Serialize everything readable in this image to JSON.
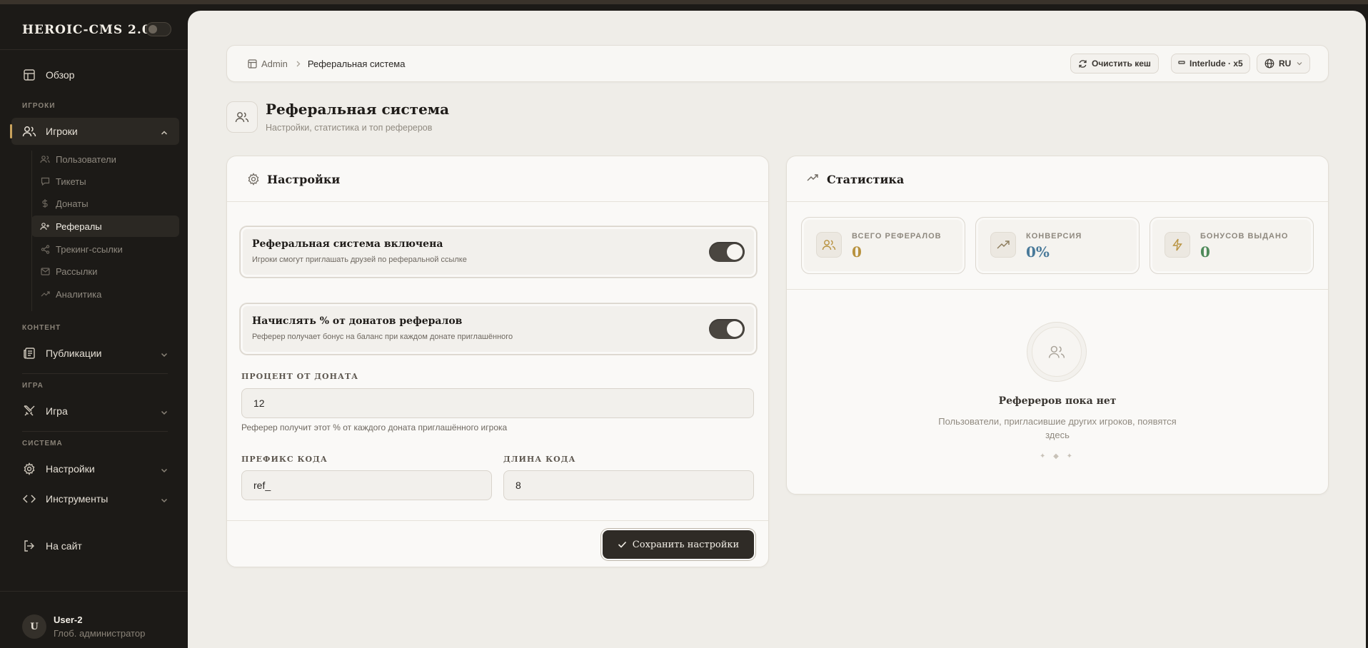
{
  "brand": {
    "name": "HEROIC-CMS 2.0"
  },
  "sidebar": {
    "overview": "Обзор",
    "sections": {
      "players": "ИГРОКИ",
      "content": "КОНТЕНТ",
      "game": "ИГРА",
      "system": "СИСТЕМА"
    },
    "players_label": "Игроки",
    "sub_items": [
      "Пользователи",
      "Тикеты",
      "Донаты",
      "Рефералы",
      "Трекинг-ссылки",
      "Рассылки",
      "Аналитика"
    ],
    "publications": "Публикации",
    "game_label": "Игра",
    "settings": "Настройки",
    "tools": "Инструменты",
    "to_site": "На сайт"
  },
  "user": {
    "initial": "U",
    "name": "User-2",
    "role": "Глоб. администратор"
  },
  "topbar": {
    "breadcrumb_root": "Admin",
    "breadcrumb_current": "Реферальная система",
    "clear_cache": "Очистить кеш",
    "server": "Interlude · x5",
    "language": "RU"
  },
  "page": {
    "title": "Реферальная система",
    "subtitle": "Настройки, статистика и топ рефереров"
  },
  "settings_card": {
    "title": "Настройки",
    "toggle1_title": "Реферальная система включена",
    "toggle1_desc": "Игроки смогут приглашать друзей по реферальной ссылке",
    "toggle1_on": true,
    "toggle2_title": "Начислять % от донатов рефералов",
    "toggle2_desc": "Реферер получает бонус на баланс при каждом донате приглашённого",
    "toggle2_on": true,
    "percent_label": "ПРОЦЕНТ ОТ ДОНАТА",
    "percent_value": "12",
    "percent_hint": "Реферер получит этот % от каждого доната приглашённого игрока",
    "prefix_label": "ПРЕФИКС КОДА",
    "prefix_value": "ref_",
    "length_label": "ДЛИНА КОДА",
    "length_value": "8",
    "save": "Сохранить настройки"
  },
  "stats_card": {
    "title": "Статистика",
    "total_label": "ВСЕГО РЕФЕРАЛОВ",
    "total_value": "0",
    "conversion_label": "КОНВЕРСИЯ",
    "conversion_value": "0%",
    "bonuses_label": "БОНУСОВ ВЫДАНО",
    "bonuses_value": "0",
    "empty_title": "Рефереров пока нет",
    "empty_desc": "Пользователи, пригласившие других игроков, появятся здесь",
    "dots": "✦ ◆ ✦"
  },
  "colors": {
    "accent_gold": "#c9a35d",
    "total_value": "#b8923f",
    "conversion_value": "#4a7a9a",
    "bonuses_value": "#4f8a5a"
  }
}
